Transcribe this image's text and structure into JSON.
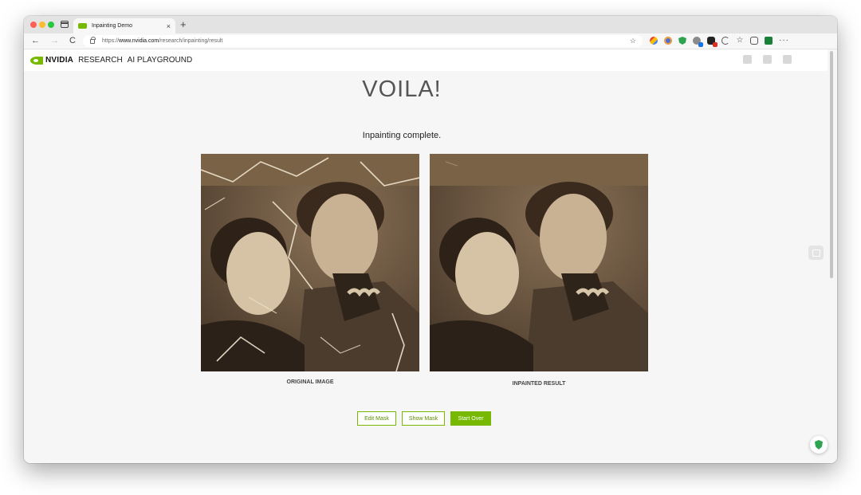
{
  "browser": {
    "tab_title": "Inpainting Demo",
    "tab_close": "×",
    "new_tab": "+",
    "url_prefix": "https://",
    "url_domain": "www.nvidia.com",
    "url_path": "/research/inpainting/result",
    "nav": {
      "back": "←",
      "forward": "→",
      "reload": "C"
    },
    "star": "☆",
    "more": "···"
  },
  "site": {
    "brand": "NVIDIA",
    "brand_sub": "RESEARCH",
    "brand_sub2": "AI PLAYGROUND",
    "social_icons": [
      "facebook-icon",
      "mail-icon",
      "linkedin-icon",
      "twitter-icon"
    ],
    "twitter_glyph": "🐦"
  },
  "main": {
    "title": "VOILA!",
    "subtitle": "Inpainting complete.",
    "original_caption": "ORIGINAL IMAGE",
    "result_caption": "INPAINTED RESULT"
  },
  "buttons": {
    "edit_mask": "Edit Mask",
    "show_mask": "Show Mask",
    "start_over": "Start Over"
  },
  "colors": {
    "accent": "#76b900",
    "photo_sepia": "#6e5a44"
  }
}
